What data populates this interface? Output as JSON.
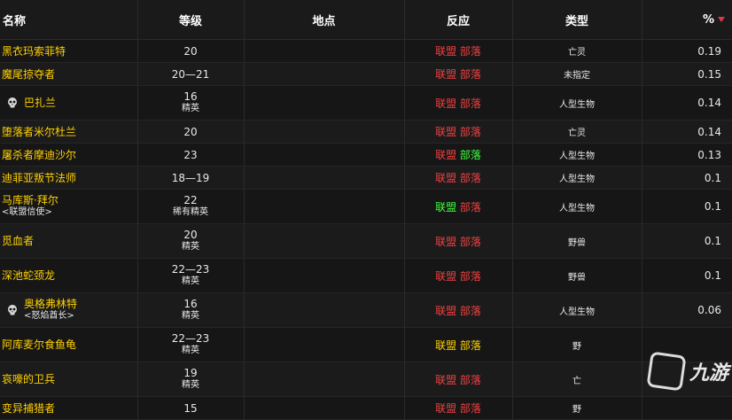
{
  "header": {
    "name": "名称",
    "level": "等级",
    "location": "地点",
    "reaction": "反应",
    "type": "类型",
    "percent": "%"
  },
  "rows": [
    {
      "name": "黑衣玛索菲特",
      "sub": "",
      "skull": false,
      "level": "20",
      "classification": "",
      "alliance": "联盟",
      "horde": "部落",
      "alliance_color": "red",
      "horde_color": "red",
      "type": "亡灵",
      "percent": "0.19"
    },
    {
      "name": "魔尾掠夺者",
      "sub": "",
      "skull": false,
      "level": "20—21",
      "classification": "",
      "alliance": "联盟",
      "horde": "部落",
      "alliance_color": "red",
      "horde_color": "red",
      "type": "未指定",
      "percent": "0.15"
    },
    {
      "name": "巴扎兰",
      "sub": "",
      "skull": true,
      "level": "16",
      "classification": "精英",
      "alliance": "联盟",
      "horde": "部落",
      "alliance_color": "red",
      "horde_color": "red",
      "type": "人型生物",
      "percent": "0.14"
    },
    {
      "name": "堕落者米尔杜兰",
      "sub": "",
      "skull": false,
      "level": "20",
      "classification": "",
      "alliance": "联盟",
      "horde": "部落",
      "alliance_color": "red",
      "horde_color": "red",
      "type": "亡灵",
      "percent": "0.14"
    },
    {
      "name": "屠杀者摩迪沙尔",
      "sub": "",
      "skull": false,
      "level": "23",
      "classification": "",
      "alliance": "联盟",
      "horde": "部落",
      "alliance_color": "red",
      "horde_color": "green",
      "type": "人型生物",
      "percent": "0.13"
    },
    {
      "name": "迪菲亚叛节法师",
      "sub": "",
      "skull": false,
      "level": "18—19",
      "classification": "",
      "alliance": "联盟",
      "horde": "部落",
      "alliance_color": "red",
      "horde_color": "red",
      "type": "人型生物",
      "percent": "0.1"
    },
    {
      "name": "马库斯·拜尔",
      "sub": "<联盟信使>",
      "skull": false,
      "level": "22",
      "classification": "稀有精英",
      "alliance": "联盟",
      "horde": "部落",
      "alliance_color": "green",
      "horde_color": "red",
      "type": "人型生物",
      "percent": "0.1"
    },
    {
      "name": "觅血者",
      "sub": "",
      "skull": false,
      "level": "20",
      "classification": "精英",
      "alliance": "联盟",
      "horde": "部落",
      "alliance_color": "red",
      "horde_color": "red",
      "type": "野兽",
      "percent": "0.1"
    },
    {
      "name": "深池蛇颈龙",
      "sub": "",
      "skull": false,
      "level": "22—23",
      "classification": "精英",
      "alliance": "联盟",
      "horde": "部落",
      "alliance_color": "red",
      "horde_color": "red",
      "type": "野兽",
      "percent": "0.1"
    },
    {
      "name": "奥格弗林特",
      "sub": "<怒焰酋长>",
      "skull": true,
      "level": "16",
      "classification": "精英",
      "alliance": "联盟",
      "horde": "部落",
      "alliance_color": "red",
      "horde_color": "red",
      "type": "人型生物",
      "percent": "0.06"
    },
    {
      "name": "阿库麦尔食鱼龟",
      "sub": "",
      "skull": false,
      "level": "22—23",
      "classification": "精英",
      "alliance": "联盟",
      "horde": "部落",
      "alliance_color": "yellow",
      "horde_color": "yellow",
      "type": "野",
      "percent": ""
    },
    {
      "name": "哀嚎的卫兵",
      "sub": "",
      "skull": false,
      "level": "19",
      "classification": "精英",
      "alliance": "联盟",
      "horde": "部落",
      "alliance_color": "red",
      "horde_color": "red",
      "type": "亡",
      "percent": ""
    },
    {
      "name": "变异捕猎者",
      "sub": "",
      "skull": false,
      "level": "15",
      "classification": "",
      "alliance": "联盟",
      "horde": "部落",
      "alliance_color": "red",
      "horde_color": "red",
      "type": "野",
      "percent": ""
    }
  ],
  "watermark": {
    "text": "九游"
  },
  "colors": {
    "hostile": "#f04040",
    "friendly": "#40ff40",
    "neutral": "#ffd100",
    "name": "#ffd100",
    "sort_arrow": "#e0384a"
  },
  "icons": {
    "sort": "sort-desc-arrow-icon",
    "boss": "skull-icon"
  }
}
